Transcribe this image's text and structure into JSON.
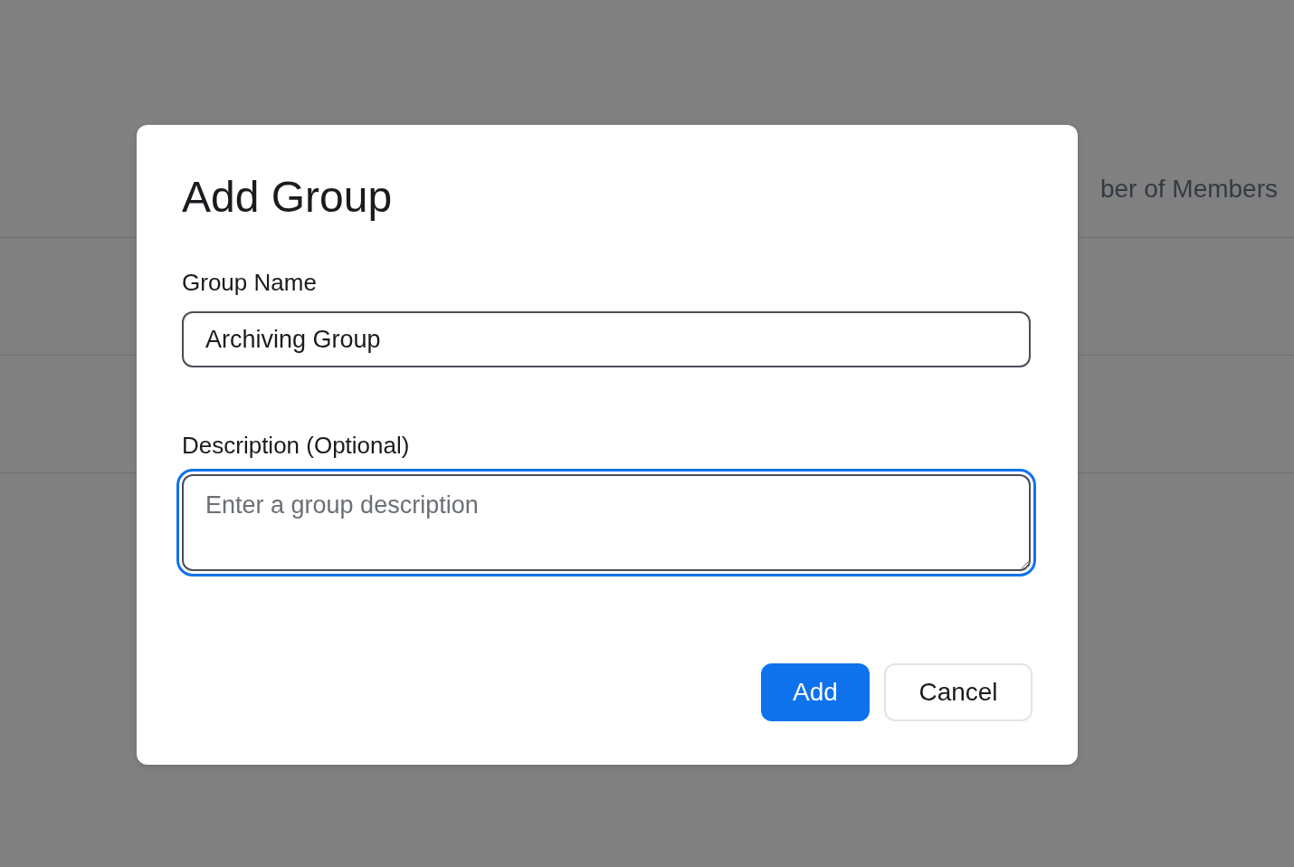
{
  "background_table": {
    "header": "ber of Members"
  },
  "dialog": {
    "title": "Add Group",
    "fields": [
      {
        "label": "Group Name",
        "kind": "input",
        "value": "Archiving Group",
        "focused": false
      },
      {
        "label": "Description (Optional)",
        "kind": "textarea",
        "placeholder": "Enter a group description",
        "focused": true
      }
    ],
    "buttons": [
      {
        "label": "Add",
        "kind": "primary"
      },
      {
        "label": "Cancel",
        "kind": "secondary"
      }
    ]
  }
}
